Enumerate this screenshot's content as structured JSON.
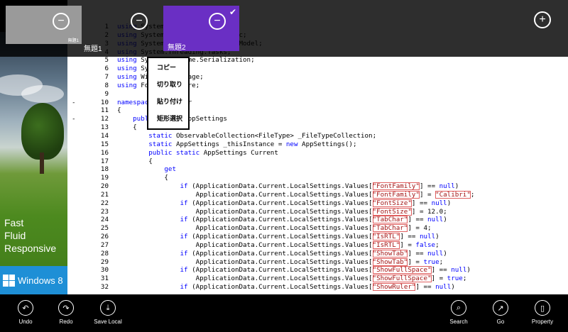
{
  "tabs": [
    {
      "label": "無題1",
      "close_glyph": "−",
      "thumb_label": "無題1",
      "selected": false
    },
    {
      "label": "無題2",
      "close_glyph": "−",
      "selected": true,
      "check_glyph": "✔"
    }
  ],
  "add_tab_glyph": "+",
  "promo": {
    "lines": [
      "Fast",
      "Fluid",
      "Responsive"
    ],
    "brand": "Windows 8"
  },
  "context_menu": [
    "コピー",
    "切り取り",
    "貼り付け",
    "矩形選択"
  ],
  "code_lines": [
    {
      "n": "1",
      "fold": "",
      "html": "<span class=\"kw\">using</span> System;"
    },
    {
      "n": "2",
      "fold": "",
      "html": "<span class=\"kw\">using</span> System.Collections.Generic;"
    },
    {
      "n": "3",
      "fold": "",
      "html": "<span class=\"kw\">using</span> System.Collections.ObjectModel;"
    },
    {
      "n": "4",
      "fold": "",
      "html": "<span class=\"kw\">using</span> System.Threading.Tasks;"
    },
    {
      "n": "5",
      "fold": "",
      "html": "<span class=\"kw\">using</span> System.Runtime.Serialization;"
    },
    {
      "n": "6",
      "fold": "",
      "html": "<span class=\"kw\">using</span> System.IO;"
    },
    {
      "n": "7",
      "fold": "",
      "html": "<span class=\"kw\">using</span> Windows.Storage;"
    },
    {
      "n": "8",
      "fold": "",
      "html": "<span class=\"kw\">using</span> FooEditor.Core;"
    },
    {
      "n": "9",
      "fold": "",
      "html": ""
    },
    {
      "n": "10",
      "fold": "-",
      "html": "<span class=\"kw\">namespace</span> FooEditor"
    },
    {
      "n": "11",
      "fold": "",
      "html": "{"
    },
    {
      "n": "12",
      "fold": "-",
      "html": "    <span class=\"kw\">public</span> <span class=\"kw\">class</span> AppSettings"
    },
    {
      "n": "13",
      "fold": "",
      "html": "    {"
    },
    {
      "n": "14",
      "fold": "",
      "html": "        <span class=\"kw\">static</span> ObservableCollection&lt;FileType&gt; _FileTypeCollection;"
    },
    {
      "n": "15",
      "fold": "",
      "html": "        <span class=\"kw\">static</span> AppSettings _thisInstance = <span class=\"kw\">new</span> AppSettings();"
    },
    {
      "n": "16",
      "fold": "",
      "html": "        <span class=\"kw\">public</span> <span class=\"kw\">static</span> AppSettings Current"
    },
    {
      "n": "17",
      "fold": "",
      "html": "        {"
    },
    {
      "n": "18",
      "fold": "",
      "html": "            <span class=\"kw\">get</span>"
    },
    {
      "n": "19",
      "fold": "",
      "html": "            {"
    },
    {
      "n": "20",
      "fold": "",
      "html": "                <span class=\"kw\">if</span> (ApplicationData.Current.LocalSettings.Values[<span class=\"str\">\"FontFamily\"</span>] == <span class=\"kw\">null</span>)"
    },
    {
      "n": "21",
      "fold": "",
      "html": "                    ApplicationData.Current.LocalSettings.Values[<span class=\"str\">\"FontFamily\"</span>] = <span class=\"str\">\"Calibri\"</span>;"
    },
    {
      "n": "22",
      "fold": "",
      "html": "                <span class=\"kw\">if</span> (ApplicationData.Current.LocalSettings.Values[<span class=\"str\">\"FontSize\"</span>] == <span class=\"kw\">null</span>)"
    },
    {
      "n": "23",
      "fold": "",
      "html": "                    ApplicationData.Current.LocalSettings.Values[<span class=\"str\">\"FontSize\"</span>] = 12.0;"
    },
    {
      "n": "24",
      "fold": "",
      "html": "                <span class=\"kw\">if</span> (ApplicationData.Current.LocalSettings.Values[<span class=\"str\">\"TabChar\"</span>] == <span class=\"kw\">null</span>)"
    },
    {
      "n": "25",
      "fold": "",
      "html": "                    ApplicationData.Current.LocalSettings.Values[<span class=\"str\">\"TabChar\"</span>] = 4;"
    },
    {
      "n": "26",
      "fold": "",
      "html": "                <span class=\"kw\">if</span> (ApplicationData.Current.LocalSettings.Values[<span class=\"str\">\"IsRTL\"</span>] == <span class=\"kw\">null</span>)"
    },
    {
      "n": "27",
      "fold": "",
      "html": "                    ApplicationData.Current.LocalSettings.Values[<span class=\"str\">\"IsRTL\"</span>] = <span class=\"kw\">false</span>;"
    },
    {
      "n": "28",
      "fold": "",
      "html": "                <span class=\"kw\">if</span> (ApplicationData.Current.LocalSettings.Values[<span class=\"str\">\"ShowTab\"</span>] == <span class=\"kw\">null</span>)"
    },
    {
      "n": "29",
      "fold": "",
      "html": "                    ApplicationData.Current.LocalSettings.Values[<span class=\"str\">\"ShowTab\"</span>] = <span class=\"kw\">true</span>;"
    },
    {
      "n": "30",
      "fold": "",
      "html": "                <span class=\"kw\">if</span> (ApplicationData.Current.LocalSettings.Values[<span class=\"str\">\"ShowFullSpace\"</span>] == <span class=\"kw\">null</span>)"
    },
    {
      "n": "31",
      "fold": "",
      "html": "                    ApplicationData.Current.LocalSettings.Values[<span class=\"str\">\"ShowFullSpace\"</span>] = <span class=\"kw\">true</span>;"
    },
    {
      "n": "32",
      "fold": "",
      "html": "                <span class=\"kw\">if</span> (ApplicationData.Current.LocalSettings.Values[<span class=\"str\">\"ShowRuler\"</span>] == <span class=\"kw\">null</span>)"
    }
  ],
  "appbar": {
    "left": [
      {
        "label": "Undo",
        "icon": "undo-icon",
        "glyph": "↶"
      },
      {
        "label": "Redo",
        "icon": "redo-icon",
        "glyph": "↷"
      },
      {
        "label": "Save Local",
        "icon": "save-local-icon",
        "glyph": "⤓"
      }
    ],
    "right": [
      {
        "label": "Search",
        "icon": "search-icon",
        "glyph": "⌕"
      },
      {
        "label": "Go",
        "icon": "go-icon",
        "glyph": "↗"
      },
      {
        "label": "Property",
        "icon": "property-icon",
        "glyph": "▯"
      }
    ]
  },
  "colors": {
    "accent": "#6a2fc4",
    "tab_inactive": "#9a9a9a",
    "brand_blue": "#1e8fd6"
  }
}
